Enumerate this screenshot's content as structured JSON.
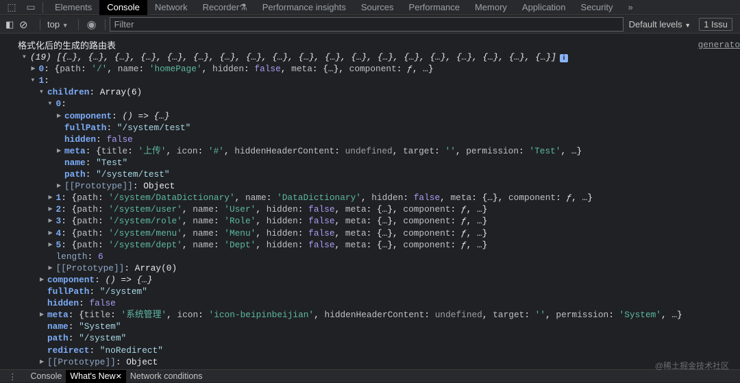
{
  "tabs": [
    "Elements",
    "Console",
    "Network",
    "Recorder",
    "Performance insights",
    "Sources",
    "Performance",
    "Memory",
    "Application",
    "Security"
  ],
  "active_tab": "Console",
  "toolbar": {
    "context": "top",
    "filter_placeholder": "Filter",
    "levels": "Default levels",
    "issues": "1 Issu"
  },
  "console": {
    "message": "格式化后的生成的路由表",
    "source": "generato",
    "lines": [
      {
        "lvl": 0,
        "arrow": "down",
        "segs": [
          [
            "i",
            "(19) [{…}, {…}, {…}, {…}, {…}, {…}, {…}, {…}, {…}, {…}, {…}, {…}, {…}, {…}, {…}, {…}, {…}, {…}, {…}]"
          ]
        ],
        "info": true
      },
      {
        "lvl": 1,
        "arrow": "right",
        "segs": [
          [
            "k",
            "0"
          ],
          [
            "p",
            ": {"
          ],
          [
            "pk",
            "path"
          ],
          [
            "p",
            ": "
          ],
          [
            "ps",
            "'/'"
          ],
          [
            "p",
            ", "
          ],
          [
            "pk",
            "name"
          ],
          [
            "p",
            ": "
          ],
          [
            "ps",
            "'homePage'"
          ],
          [
            "p",
            ", "
          ],
          [
            "pk",
            "hidden"
          ],
          [
            "p",
            ": "
          ],
          [
            "f",
            "false"
          ],
          [
            "p",
            ", "
          ],
          [
            "pk",
            "meta"
          ],
          [
            "p",
            ": {…}, "
          ],
          [
            "pk",
            "component"
          ],
          [
            "p",
            ": "
          ],
          [
            "i",
            "ƒ"
          ],
          [
            "p",
            ", …}"
          ]
        ]
      },
      {
        "lvl": 1,
        "arrow": "down",
        "segs": [
          [
            "k",
            "1"
          ],
          [
            "p",
            ":"
          ]
        ]
      },
      {
        "lvl": 2,
        "arrow": "down",
        "segs": [
          [
            "k",
            "children"
          ],
          [
            "p",
            ": Array(6)"
          ]
        ]
      },
      {
        "lvl": 3,
        "arrow": "down",
        "segs": [
          [
            "k",
            "0"
          ],
          [
            "p",
            ":"
          ]
        ]
      },
      {
        "lvl": 4,
        "arrow": "right",
        "segs": [
          [
            "k",
            "component"
          ],
          [
            "p",
            ": "
          ],
          [
            "i",
            "() => {…}"
          ]
        ]
      },
      {
        "lvl": 4,
        "segs": [
          [
            "k",
            "fullPath"
          ],
          [
            "p",
            ": "
          ],
          [
            "s",
            "\"/system/test\""
          ]
        ]
      },
      {
        "lvl": 4,
        "segs": [
          [
            "k",
            "hidden"
          ],
          [
            "p",
            ": "
          ],
          [
            "f",
            "false"
          ]
        ]
      },
      {
        "lvl": 4,
        "arrow": "right",
        "segs": [
          [
            "k",
            "meta"
          ],
          [
            "p",
            ": {"
          ],
          [
            "pk",
            "title"
          ],
          [
            "p",
            ": "
          ],
          [
            "ps",
            "'上传'"
          ],
          [
            "p",
            ", "
          ],
          [
            "pk",
            "icon"
          ],
          [
            "p",
            ": "
          ],
          [
            "ps",
            "'#'"
          ],
          [
            "p",
            ", "
          ],
          [
            "pk",
            "hiddenHeaderContent"
          ],
          [
            "p",
            ": "
          ],
          [
            "u",
            "undefined"
          ],
          [
            "p",
            ", "
          ],
          [
            "pk",
            "target"
          ],
          [
            "p",
            ": "
          ],
          [
            "ps",
            "''"
          ],
          [
            "p",
            ", "
          ],
          [
            "pk",
            "permission"
          ],
          [
            "p",
            ": "
          ],
          [
            "ps",
            "'Test'"
          ],
          [
            "p",
            ", …}"
          ]
        ]
      },
      {
        "lvl": 4,
        "segs": [
          [
            "k",
            "name"
          ],
          [
            "p",
            ": "
          ],
          [
            "s",
            "\"Test\""
          ]
        ]
      },
      {
        "lvl": 4,
        "segs": [
          [
            "k",
            "path"
          ],
          [
            "p",
            ": "
          ],
          [
            "s",
            "\"/system/test\""
          ]
        ]
      },
      {
        "lvl": 4,
        "arrow": "right",
        "segs": [
          [
            "pr",
            "[[Prototype]]"
          ],
          [
            "p",
            ": Object"
          ]
        ]
      },
      {
        "lvl": 3,
        "arrow": "right",
        "segs": [
          [
            "k",
            "1"
          ],
          [
            "p",
            ": {"
          ],
          [
            "pk",
            "path"
          ],
          [
            "p",
            ": "
          ],
          [
            "ps",
            "'/system/DataDictionary'"
          ],
          [
            "p",
            ", "
          ],
          [
            "pk",
            "name"
          ],
          [
            "p",
            ": "
          ],
          [
            "ps",
            "'DataDictionary'"
          ],
          [
            "p",
            ", "
          ],
          [
            "pk",
            "hidden"
          ],
          [
            "p",
            ": "
          ],
          [
            "f",
            "false"
          ],
          [
            "p",
            ", "
          ],
          [
            "pk",
            "meta"
          ],
          [
            "p",
            ": {…}, "
          ],
          [
            "pk",
            "component"
          ],
          [
            "p",
            ": "
          ],
          [
            "i",
            "ƒ"
          ],
          [
            "p",
            ", …}"
          ]
        ]
      },
      {
        "lvl": 3,
        "arrow": "right",
        "segs": [
          [
            "k",
            "2"
          ],
          [
            "p",
            ": {"
          ],
          [
            "pk",
            "path"
          ],
          [
            "p",
            ": "
          ],
          [
            "ps",
            "'/system/user'"
          ],
          [
            "p",
            ", "
          ],
          [
            "pk",
            "name"
          ],
          [
            "p",
            ": "
          ],
          [
            "ps",
            "'User'"
          ],
          [
            "p",
            ", "
          ],
          [
            "pk",
            "hidden"
          ],
          [
            "p",
            ": "
          ],
          [
            "f",
            "false"
          ],
          [
            "p",
            ", "
          ],
          [
            "pk",
            "meta"
          ],
          [
            "p",
            ": {…}, "
          ],
          [
            "pk",
            "component"
          ],
          [
            "p",
            ": "
          ],
          [
            "i",
            "ƒ"
          ],
          [
            "p",
            ", …}"
          ]
        ]
      },
      {
        "lvl": 3,
        "arrow": "right",
        "segs": [
          [
            "k",
            "3"
          ],
          [
            "p",
            ": {"
          ],
          [
            "pk",
            "path"
          ],
          [
            "p",
            ": "
          ],
          [
            "ps",
            "'/system/role'"
          ],
          [
            "p",
            ", "
          ],
          [
            "pk",
            "name"
          ],
          [
            "p",
            ": "
          ],
          [
            "ps",
            "'Role'"
          ],
          [
            "p",
            ", "
          ],
          [
            "pk",
            "hidden"
          ],
          [
            "p",
            ": "
          ],
          [
            "f",
            "false"
          ],
          [
            "p",
            ", "
          ],
          [
            "pk",
            "meta"
          ],
          [
            "p",
            ": {…}, "
          ],
          [
            "pk",
            "component"
          ],
          [
            "p",
            ": "
          ],
          [
            "i",
            "ƒ"
          ],
          [
            "p",
            ", …}"
          ]
        ]
      },
      {
        "lvl": 3,
        "arrow": "right",
        "segs": [
          [
            "k",
            "4"
          ],
          [
            "p",
            ": {"
          ],
          [
            "pk",
            "path"
          ],
          [
            "p",
            ": "
          ],
          [
            "ps",
            "'/system/menu'"
          ],
          [
            "p",
            ", "
          ],
          [
            "pk",
            "name"
          ],
          [
            "p",
            ": "
          ],
          [
            "ps",
            "'Menu'"
          ],
          [
            "p",
            ", "
          ],
          [
            "pk",
            "hidden"
          ],
          [
            "p",
            ": "
          ],
          [
            "f",
            "false"
          ],
          [
            "p",
            ", "
          ],
          [
            "pk",
            "meta"
          ],
          [
            "p",
            ": {…}, "
          ],
          [
            "pk",
            "component"
          ],
          [
            "p",
            ": "
          ],
          [
            "i",
            "ƒ"
          ],
          [
            "p",
            ", …}"
          ]
        ]
      },
      {
        "lvl": 3,
        "arrow": "right",
        "segs": [
          [
            "k",
            "5"
          ],
          [
            "p",
            ": {"
          ],
          [
            "pk",
            "path"
          ],
          [
            "p",
            ": "
          ],
          [
            "ps",
            "'/system/dept'"
          ],
          [
            "p",
            ", "
          ],
          [
            "pk",
            "name"
          ],
          [
            "p",
            ": "
          ],
          [
            "ps",
            "'Dept'"
          ],
          [
            "p",
            ", "
          ],
          [
            "pk",
            "hidden"
          ],
          [
            "p",
            ": "
          ],
          [
            "f",
            "false"
          ],
          [
            "p",
            ", "
          ],
          [
            "pk",
            "meta"
          ],
          [
            "p",
            ": {…}, "
          ],
          [
            "pk",
            "component"
          ],
          [
            "p",
            ": "
          ],
          [
            "i",
            "ƒ"
          ],
          [
            "p",
            ", …}"
          ]
        ]
      },
      {
        "lvl": 3,
        "segs": [
          [
            "pr",
            "length"
          ],
          [
            "p",
            ": "
          ],
          [
            "f",
            "6"
          ]
        ]
      },
      {
        "lvl": 3,
        "arrow": "right",
        "segs": [
          [
            "pr",
            "[[Prototype]]"
          ],
          [
            "p",
            ": Array(0)"
          ]
        ]
      },
      {
        "lvl": 2,
        "arrow": "right",
        "segs": [
          [
            "k",
            "component"
          ],
          [
            "p",
            ": "
          ],
          [
            "i",
            "() => {…}"
          ]
        ]
      },
      {
        "lvl": 2,
        "segs": [
          [
            "k",
            "fullPath"
          ],
          [
            "p",
            ": "
          ],
          [
            "s",
            "\"/system\""
          ]
        ]
      },
      {
        "lvl": 2,
        "segs": [
          [
            "k",
            "hidden"
          ],
          [
            "p",
            ": "
          ],
          [
            "f",
            "false"
          ]
        ]
      },
      {
        "lvl": 2,
        "arrow": "right",
        "segs": [
          [
            "k",
            "meta"
          ],
          [
            "p",
            ": {"
          ],
          [
            "pk",
            "title"
          ],
          [
            "p",
            ": "
          ],
          [
            "ps",
            "'系统管理'"
          ],
          [
            "p",
            ", "
          ],
          [
            "pk",
            "icon"
          ],
          [
            "p",
            ": "
          ],
          [
            "ps",
            "'icon-beipinbeijian'"
          ],
          [
            "p",
            ", "
          ],
          [
            "pk",
            "hiddenHeaderContent"
          ],
          [
            "p",
            ": "
          ],
          [
            "u",
            "undefined"
          ],
          [
            "p",
            ", "
          ],
          [
            "pk",
            "target"
          ],
          [
            "p",
            ": "
          ],
          [
            "ps",
            "''"
          ],
          [
            "p",
            ", "
          ],
          [
            "pk",
            "permission"
          ],
          [
            "p",
            ": "
          ],
          [
            "ps",
            "'System'"
          ],
          [
            "p",
            ", …}"
          ]
        ]
      },
      {
        "lvl": 2,
        "segs": [
          [
            "k",
            "name"
          ],
          [
            "p",
            ": "
          ],
          [
            "s",
            "\"System\""
          ]
        ]
      },
      {
        "lvl": 2,
        "segs": [
          [
            "k",
            "path"
          ],
          [
            "p",
            ": "
          ],
          [
            "s",
            "\"/system\""
          ]
        ]
      },
      {
        "lvl": 2,
        "segs": [
          [
            "k",
            "redirect"
          ],
          [
            "p",
            ": "
          ],
          [
            "s",
            "\"noRedirect\""
          ]
        ]
      },
      {
        "lvl": 2,
        "arrow": "right",
        "segs": [
          [
            "pr",
            "[[Prototype]]"
          ],
          [
            "p",
            ": Object"
          ]
        ]
      }
    ]
  },
  "drawer": {
    "tabs": [
      "Console",
      "What's New",
      "Network conditions"
    ],
    "active": "What's New"
  },
  "watermark": "@稀土掘金技术社区"
}
